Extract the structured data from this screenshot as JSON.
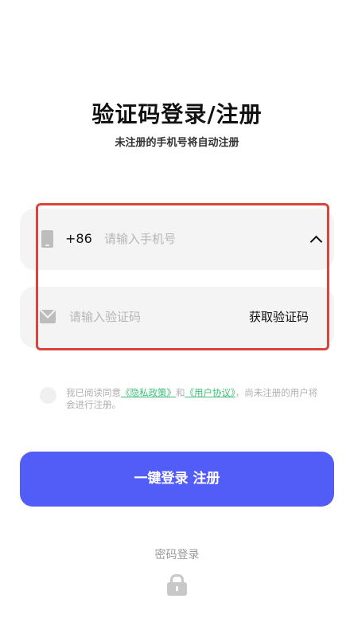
{
  "header": {
    "title": "验证码登录/注册",
    "subtitle": "未注册的手机号将自动注册"
  },
  "phone": {
    "country_code": "+86",
    "placeholder": "请输入手机号",
    "value": ""
  },
  "code": {
    "placeholder": "请输入验证码",
    "value": "",
    "get_code_label": "获取验证码"
  },
  "agreement": {
    "prefix": "我已阅读同意",
    "privacy_link": "《隐私政策》",
    "and": "和",
    "terms_link": "《用户协议》",
    "suffix": "，尚未注册的用户将会进行注册。",
    "checked": false
  },
  "login_button": {
    "label": "一键登录 注册"
  },
  "password_login": {
    "label": "密码登录"
  },
  "icons": {
    "phone": "phone-icon",
    "mail": "mail-icon",
    "chevron": "chevron-up-icon",
    "lock": "lock-icon"
  },
  "colors": {
    "primary": "#525cf6",
    "link": "#3fc07a",
    "highlight_frame": "#d9453a",
    "field_bg": "#f4f4f5"
  }
}
